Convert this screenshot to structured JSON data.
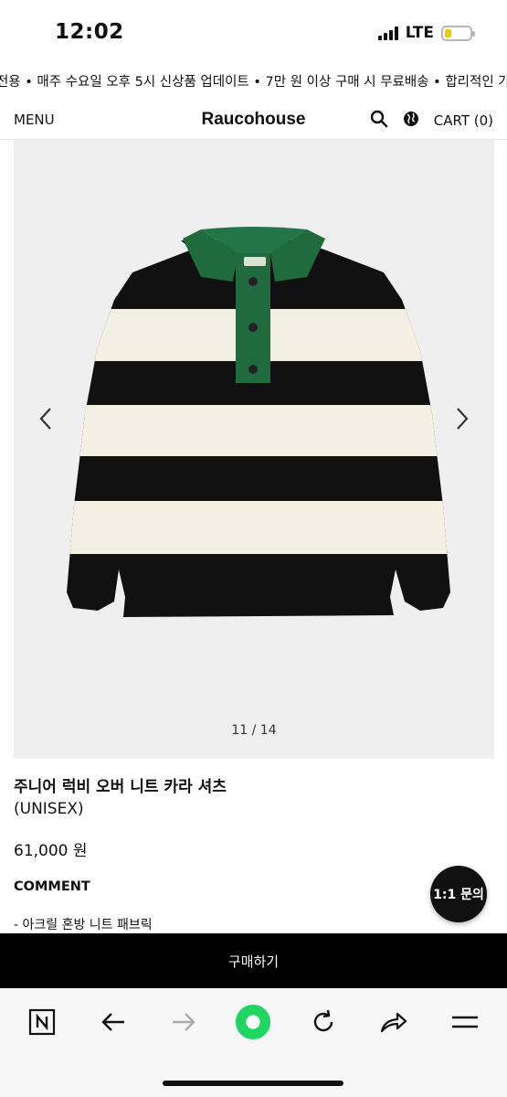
{
  "status_bar": {
    "time": "12:02",
    "network": "LTE",
    "battery_color": "#f5c900"
  },
  "promo": {
    "text": "원 전용 • 매주 수요일 오후 5시 신상품 업데이트 • 7만 원 이상 구매 시 무료배송 • 합리적인 가"
  },
  "header": {
    "menu_label": "MENU",
    "logo": "Raucohouse",
    "cart_label": "CART (0)",
    "icons": [
      "search-icon",
      "globe-icon"
    ]
  },
  "gallery": {
    "counter": "11 / 14",
    "current": 11,
    "total": 14,
    "product_image": "striped-polo-knit-sweater"
  },
  "product": {
    "name": "주니어 럭비 오버 니트 카라 셔츠",
    "subtitle": "(UNISEX)",
    "price": "61,000 원",
    "comment_heading": "COMMENT",
    "description": "- 아크릴 혼방 니트 패브릭"
  },
  "chat_button": {
    "label": "1:1 문의"
  },
  "buy_bar": {
    "label": "구매하기"
  },
  "browser_bar": {
    "icons": [
      "naver-n-icon",
      "back-arrow-icon",
      "forward-arrow-icon",
      "home-circle-icon",
      "reload-icon",
      "share-icon",
      "menu-icon"
    ],
    "accent_color": "#1ed760"
  }
}
